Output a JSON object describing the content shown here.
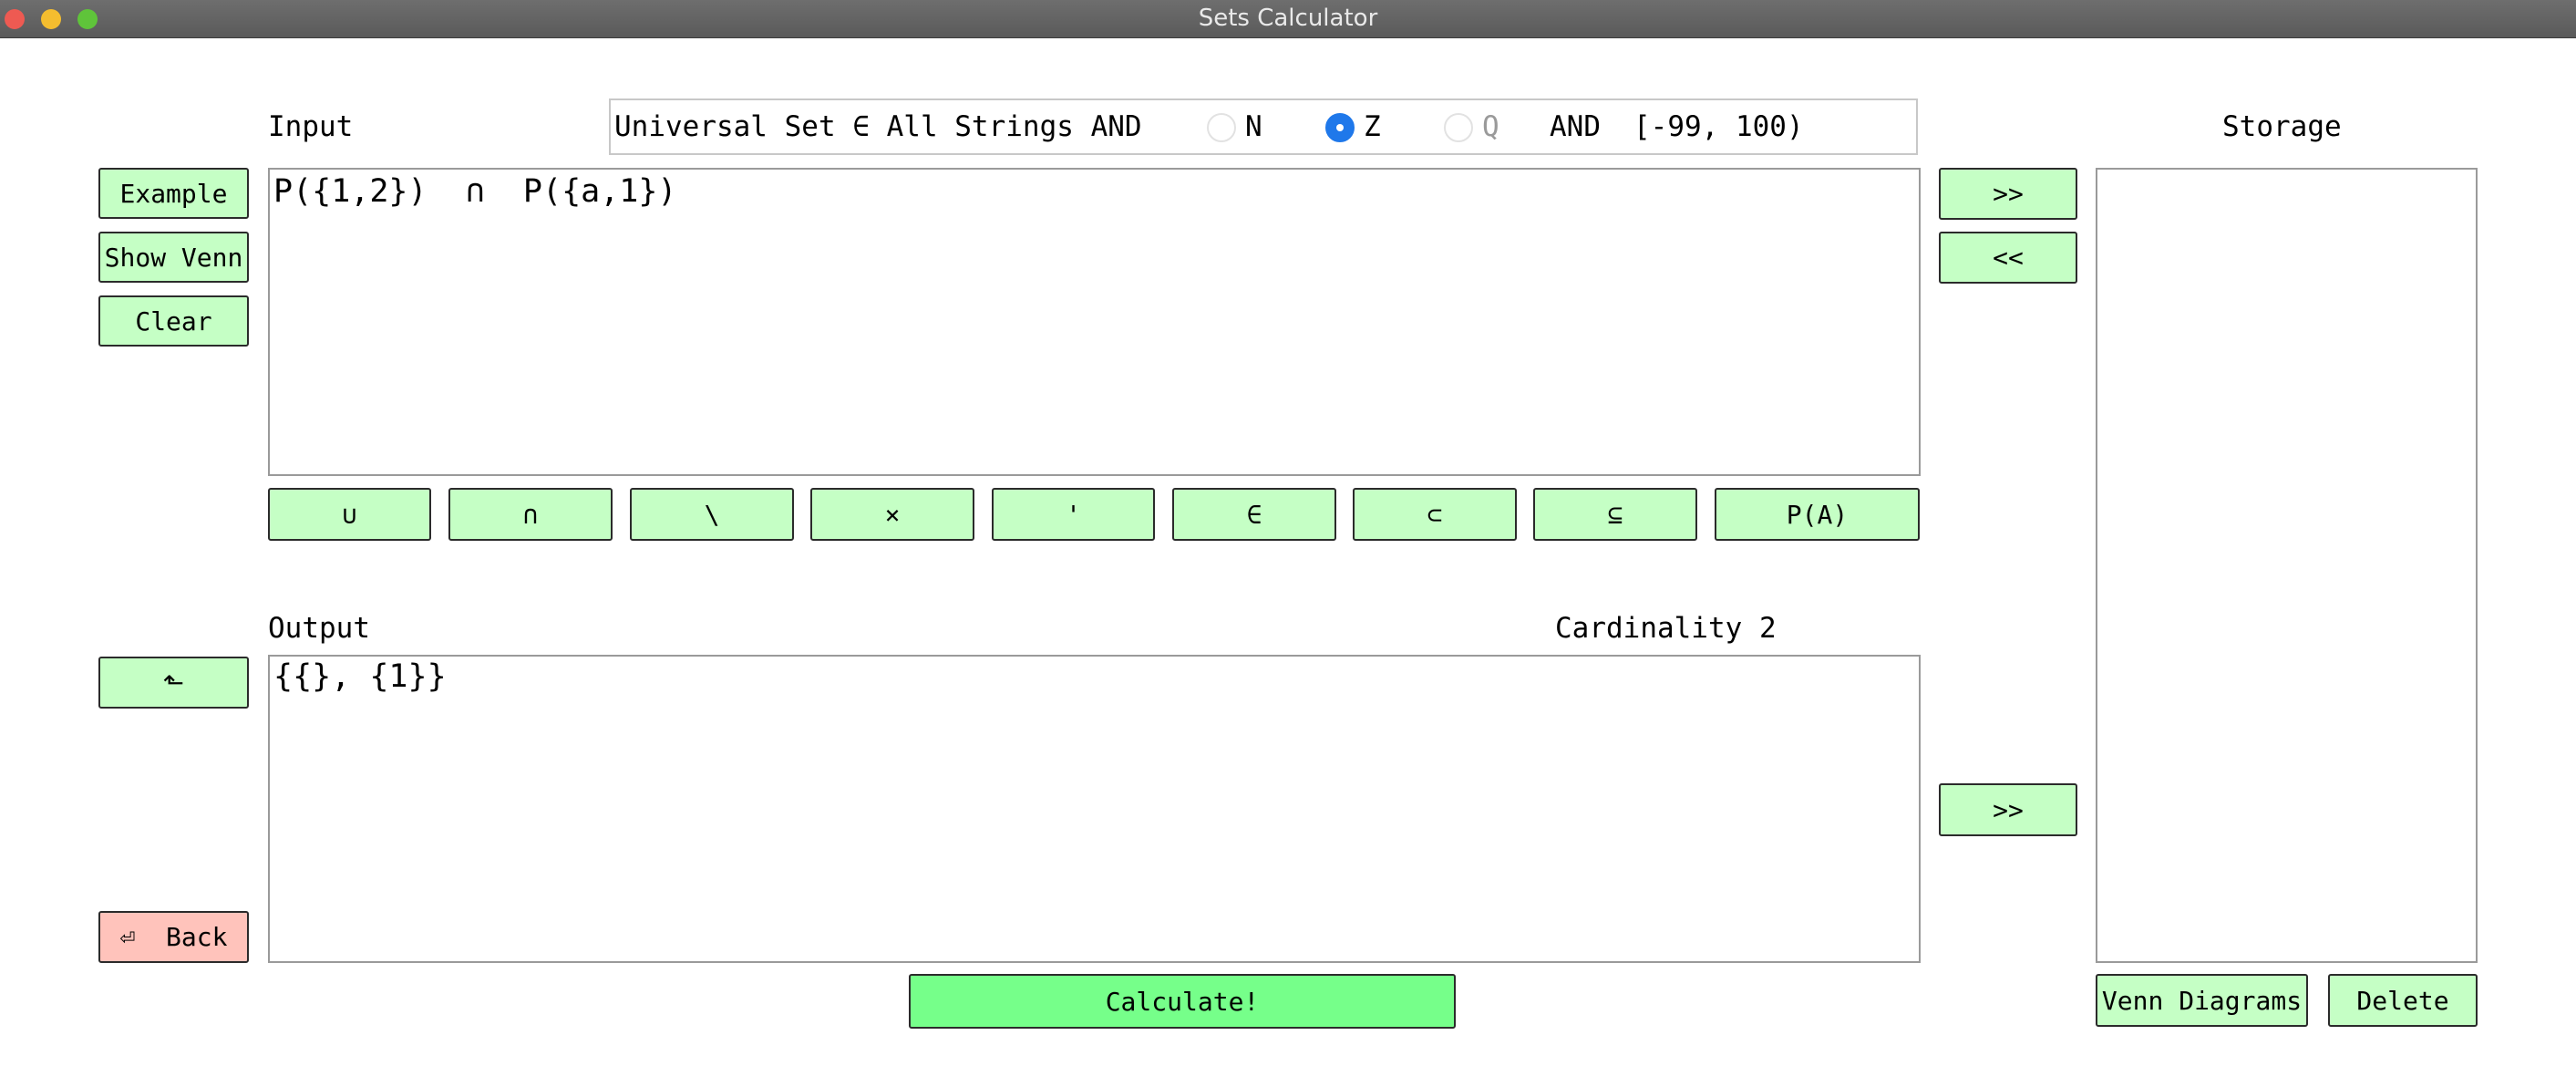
{
  "window": {
    "title": "Sets Calculator"
  },
  "labels": {
    "input": "Input",
    "output": "Output",
    "storage": "Storage",
    "cardinality": "Cardinality 2"
  },
  "universal_set": {
    "prefix": "Universal Set ∈ All Strings AND",
    "options": [
      {
        "label": "N",
        "selected": false
      },
      {
        "label": "Z",
        "selected": true
      },
      {
        "label": "Q",
        "selected": false
      }
    ],
    "and_label": "AND",
    "range": "[-99, 100)"
  },
  "input": {
    "value": "P({1,2})  ∩  P({a,1})"
  },
  "output": {
    "value": "{{}, {1}}"
  },
  "left_buttons": {
    "example": "Example",
    "show_venn": "Show Venn",
    "clear": "Clear",
    "copy_down": "⬑",
    "back": "⏎  Back"
  },
  "operators": [
    "∪",
    "∩",
    "\\",
    "×",
    "'",
    "∈",
    "⊂",
    "⊆",
    "P(A)"
  ],
  "storage_buttons": {
    "store_input": ">>",
    "load_input": "<<",
    "store_output": ">>",
    "venn_diagrams": "Venn Diagrams",
    "delete": "Delete"
  },
  "calculate": "Calculate!",
  "colors": {
    "button": "#c5ffc5",
    "calculate": "#76ff8a",
    "back": "#ffc3bb",
    "radio_selected": "#1f78ea"
  }
}
